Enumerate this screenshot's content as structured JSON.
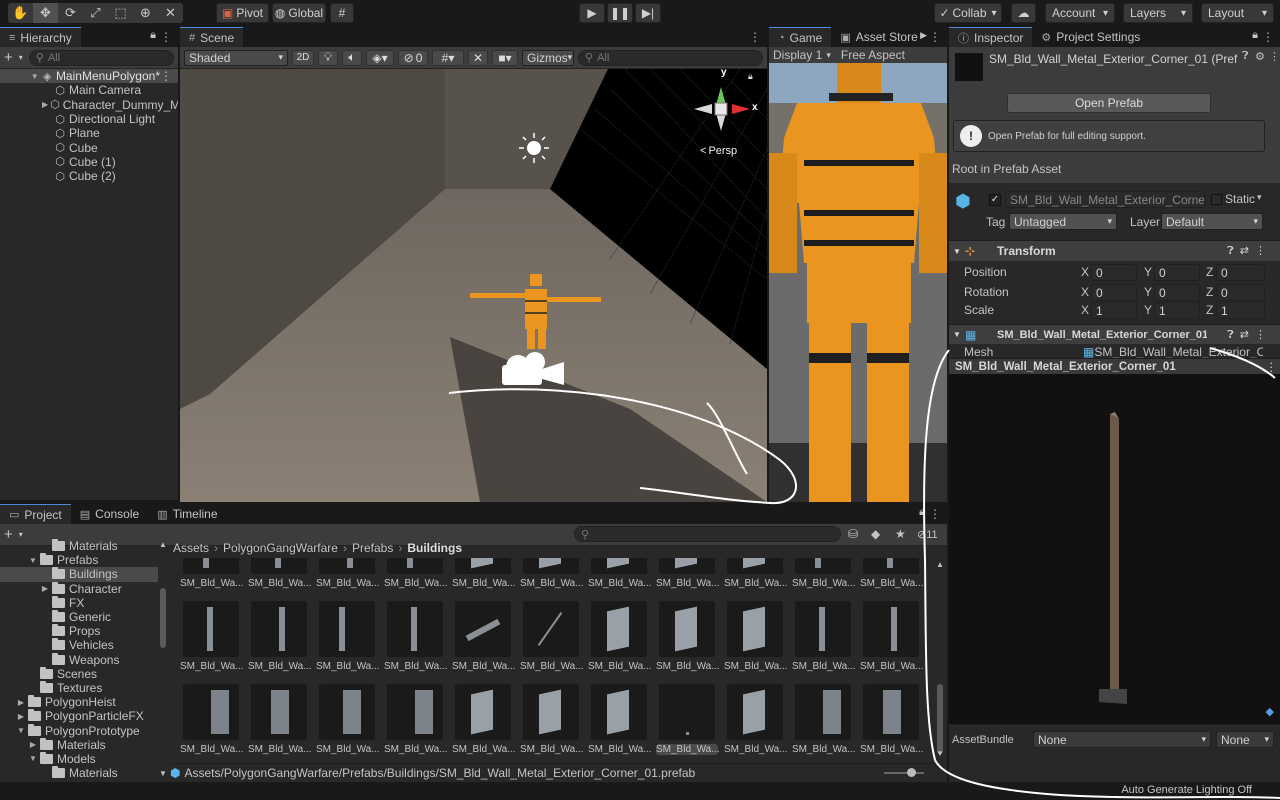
{
  "toolbar": {
    "pivot_label": "Pivot",
    "global_label": "Global",
    "collab_label": "Collab",
    "account_label": "Account",
    "layers_label": "Layers",
    "layout_label": "Layout",
    "tools": [
      "hand-icon",
      "move-icon",
      "rotate-icon",
      "scale-icon",
      "rect-icon",
      "transform-icon",
      "custom-tool-icon"
    ]
  },
  "hierarchy": {
    "tab_label": "Hierarchy",
    "search_placeholder": "All",
    "scene_name": "MainMenuPolygon*",
    "items": [
      "Main Camera",
      "Character_Dummy_M",
      "Directional Light",
      "Plane",
      "Cube",
      "Cube (1)",
      "Cube (2)"
    ]
  },
  "scene": {
    "tab_label": "Scene",
    "shading_mode": "Shaded",
    "mode_2d": "2D",
    "hidden_count": "0",
    "gizmos_label": "Gizmos",
    "search_placeholder": "All",
    "persp_label": "Persp",
    "axis_x": "x",
    "axis_y": "y"
  },
  "game": {
    "tab_label": "Game",
    "asset_store_label": "Asset Store",
    "display_label": "Display 1",
    "aspect_label": "Free Aspect"
  },
  "inspector": {
    "tab_label": "Inspector",
    "settings_tab_label": "Project Settings",
    "asset_title": "SM_Bld_Wall_Metal_Exterior_Corner_01 (Pref",
    "open_prefab_label": "Open Prefab",
    "info_text": "Open Prefab for full editing support.",
    "root_label": "Root in Prefab Asset",
    "object_name": "SM_Bld_Wall_Metal_Exterior_Corner_",
    "static_label": "Static",
    "tag_label": "Tag",
    "tag_value": "Untagged",
    "layer_label": "Layer",
    "layer_value": "Default",
    "transform_title": "Transform",
    "transform_rows": [
      {
        "label": "Position",
        "x": "0",
        "y": "0",
        "z": "0"
      },
      {
        "label": "Rotation",
        "x": "0",
        "y": "0",
        "z": "0"
      },
      {
        "label": "Scale",
        "x": "1",
        "y": "1",
        "z": "1"
      }
    ],
    "mesh_component_title": "SM_Bld_Wall_Metal_Exterior_Corner_01",
    "mesh_label": "Mesh",
    "mesh_value": "SM_Bld_Wall_Metal_Exterior_Co",
    "preview_title": "SM_Bld_Wall_Metal_Exterior_Corner_01",
    "assetbundle_label": "AssetBundle",
    "assetbundle_value": "None",
    "assetbundle_variant": "None"
  },
  "project": {
    "tab_label": "Project",
    "console_label": "Console",
    "timeline_label": "Timeline",
    "hidden_count": "11",
    "breadcrumb": [
      "Assets",
      "PolygonGangWarfare",
      "Prefabs",
      "Buildings"
    ],
    "tree": [
      {
        "label": "Materials",
        "indent": 2,
        "arrow": ""
      },
      {
        "label": "Prefabs",
        "indent": 1,
        "arrow": "▼"
      },
      {
        "label": "Buildings",
        "indent": 2,
        "arrow": "",
        "selected": true
      },
      {
        "label": "Character",
        "indent": 2,
        "arrow": "▶"
      },
      {
        "label": "FX",
        "indent": 2,
        "arrow": ""
      },
      {
        "label": "Generic",
        "indent": 2,
        "arrow": ""
      },
      {
        "label": "Props",
        "indent": 2,
        "arrow": ""
      },
      {
        "label": "Vehicles",
        "indent": 2,
        "arrow": ""
      },
      {
        "label": "Weapons",
        "indent": 2,
        "arrow": ""
      },
      {
        "label": "Scenes",
        "indent": 1,
        "arrow": ""
      },
      {
        "label": "Textures",
        "indent": 1,
        "arrow": ""
      },
      {
        "label": "PolygonHeist",
        "indent": 0,
        "arrow": "▶"
      },
      {
        "label": "PolygonParticleFX",
        "indent": 0,
        "arrow": "▶"
      },
      {
        "label": "PolygonPrototype",
        "indent": 0,
        "arrow": "▼"
      },
      {
        "label": "Materials",
        "indent": 1,
        "arrow": "▶"
      },
      {
        "label": "Models",
        "indent": 1,
        "arrow": "▼"
      },
      {
        "label": "Materials",
        "indent": 2,
        "arrow": ""
      }
    ],
    "asset_label": "SM_Bld_Wa...",
    "selected_path": "Assets/PolygonGangWarfare/Prefabs/Buildings/SM_Bld_Wall_Metal_Exterior_Corner_01.prefab"
  },
  "status": {
    "lighting_text": "Auto Generate Lighting Off"
  }
}
